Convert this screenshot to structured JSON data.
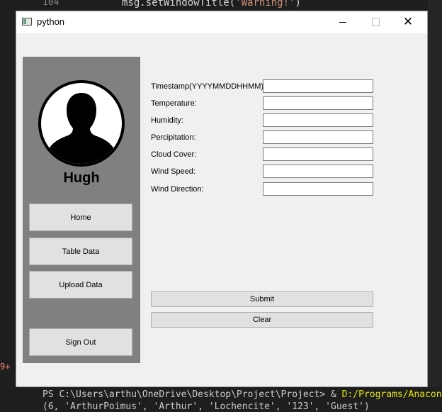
{
  "background": {
    "editor_line_number": "104",
    "editor_code_prefix": "msg.setWindowTitle(",
    "editor_code_string": "'Warning!'",
    "editor_code_suffix": ")",
    "side_marker": "9+",
    "terminal_line1_prefix": "PS C:\\Users\\arthu\\OneDrive\\Desktop\\Project\\Project> & ",
    "terminal_line1_path": "D:/Programs/Anaconda/p",
    "terminal_line2": "(6, 'ArthurPoimus', 'Arthur', 'Lochencite', '123', 'Guest')"
  },
  "window": {
    "title": "python",
    "icon": "python-window-icon",
    "controls": [
      "minimize-icon",
      "maximize-icon",
      "close-icon"
    ]
  },
  "sidebar": {
    "avatar_icon": "user-silhouette-icon",
    "user_name": "Hugh",
    "buttons": [
      {
        "label": "Home"
      },
      {
        "label": "Table Data"
      },
      {
        "label": "Upload Data"
      },
      {
        "label": "Sign Out"
      }
    ],
    "background_color": "#808080"
  },
  "form": {
    "fields": [
      {
        "label": "Timestamp(YYYYMMDDHHMM):",
        "value": ""
      },
      {
        "label": "Temperature:",
        "value": ""
      },
      {
        "label": "Humidity:",
        "value": ""
      },
      {
        "label": "Percipitation:",
        "value": ""
      },
      {
        "label": "Cloud Cover:",
        "value": ""
      },
      {
        "label": "Wind Speed:",
        "value": ""
      },
      {
        "label": "Wind Direction:",
        "value": ""
      }
    ],
    "submit_label": "Submit",
    "clear_label": "Clear"
  }
}
